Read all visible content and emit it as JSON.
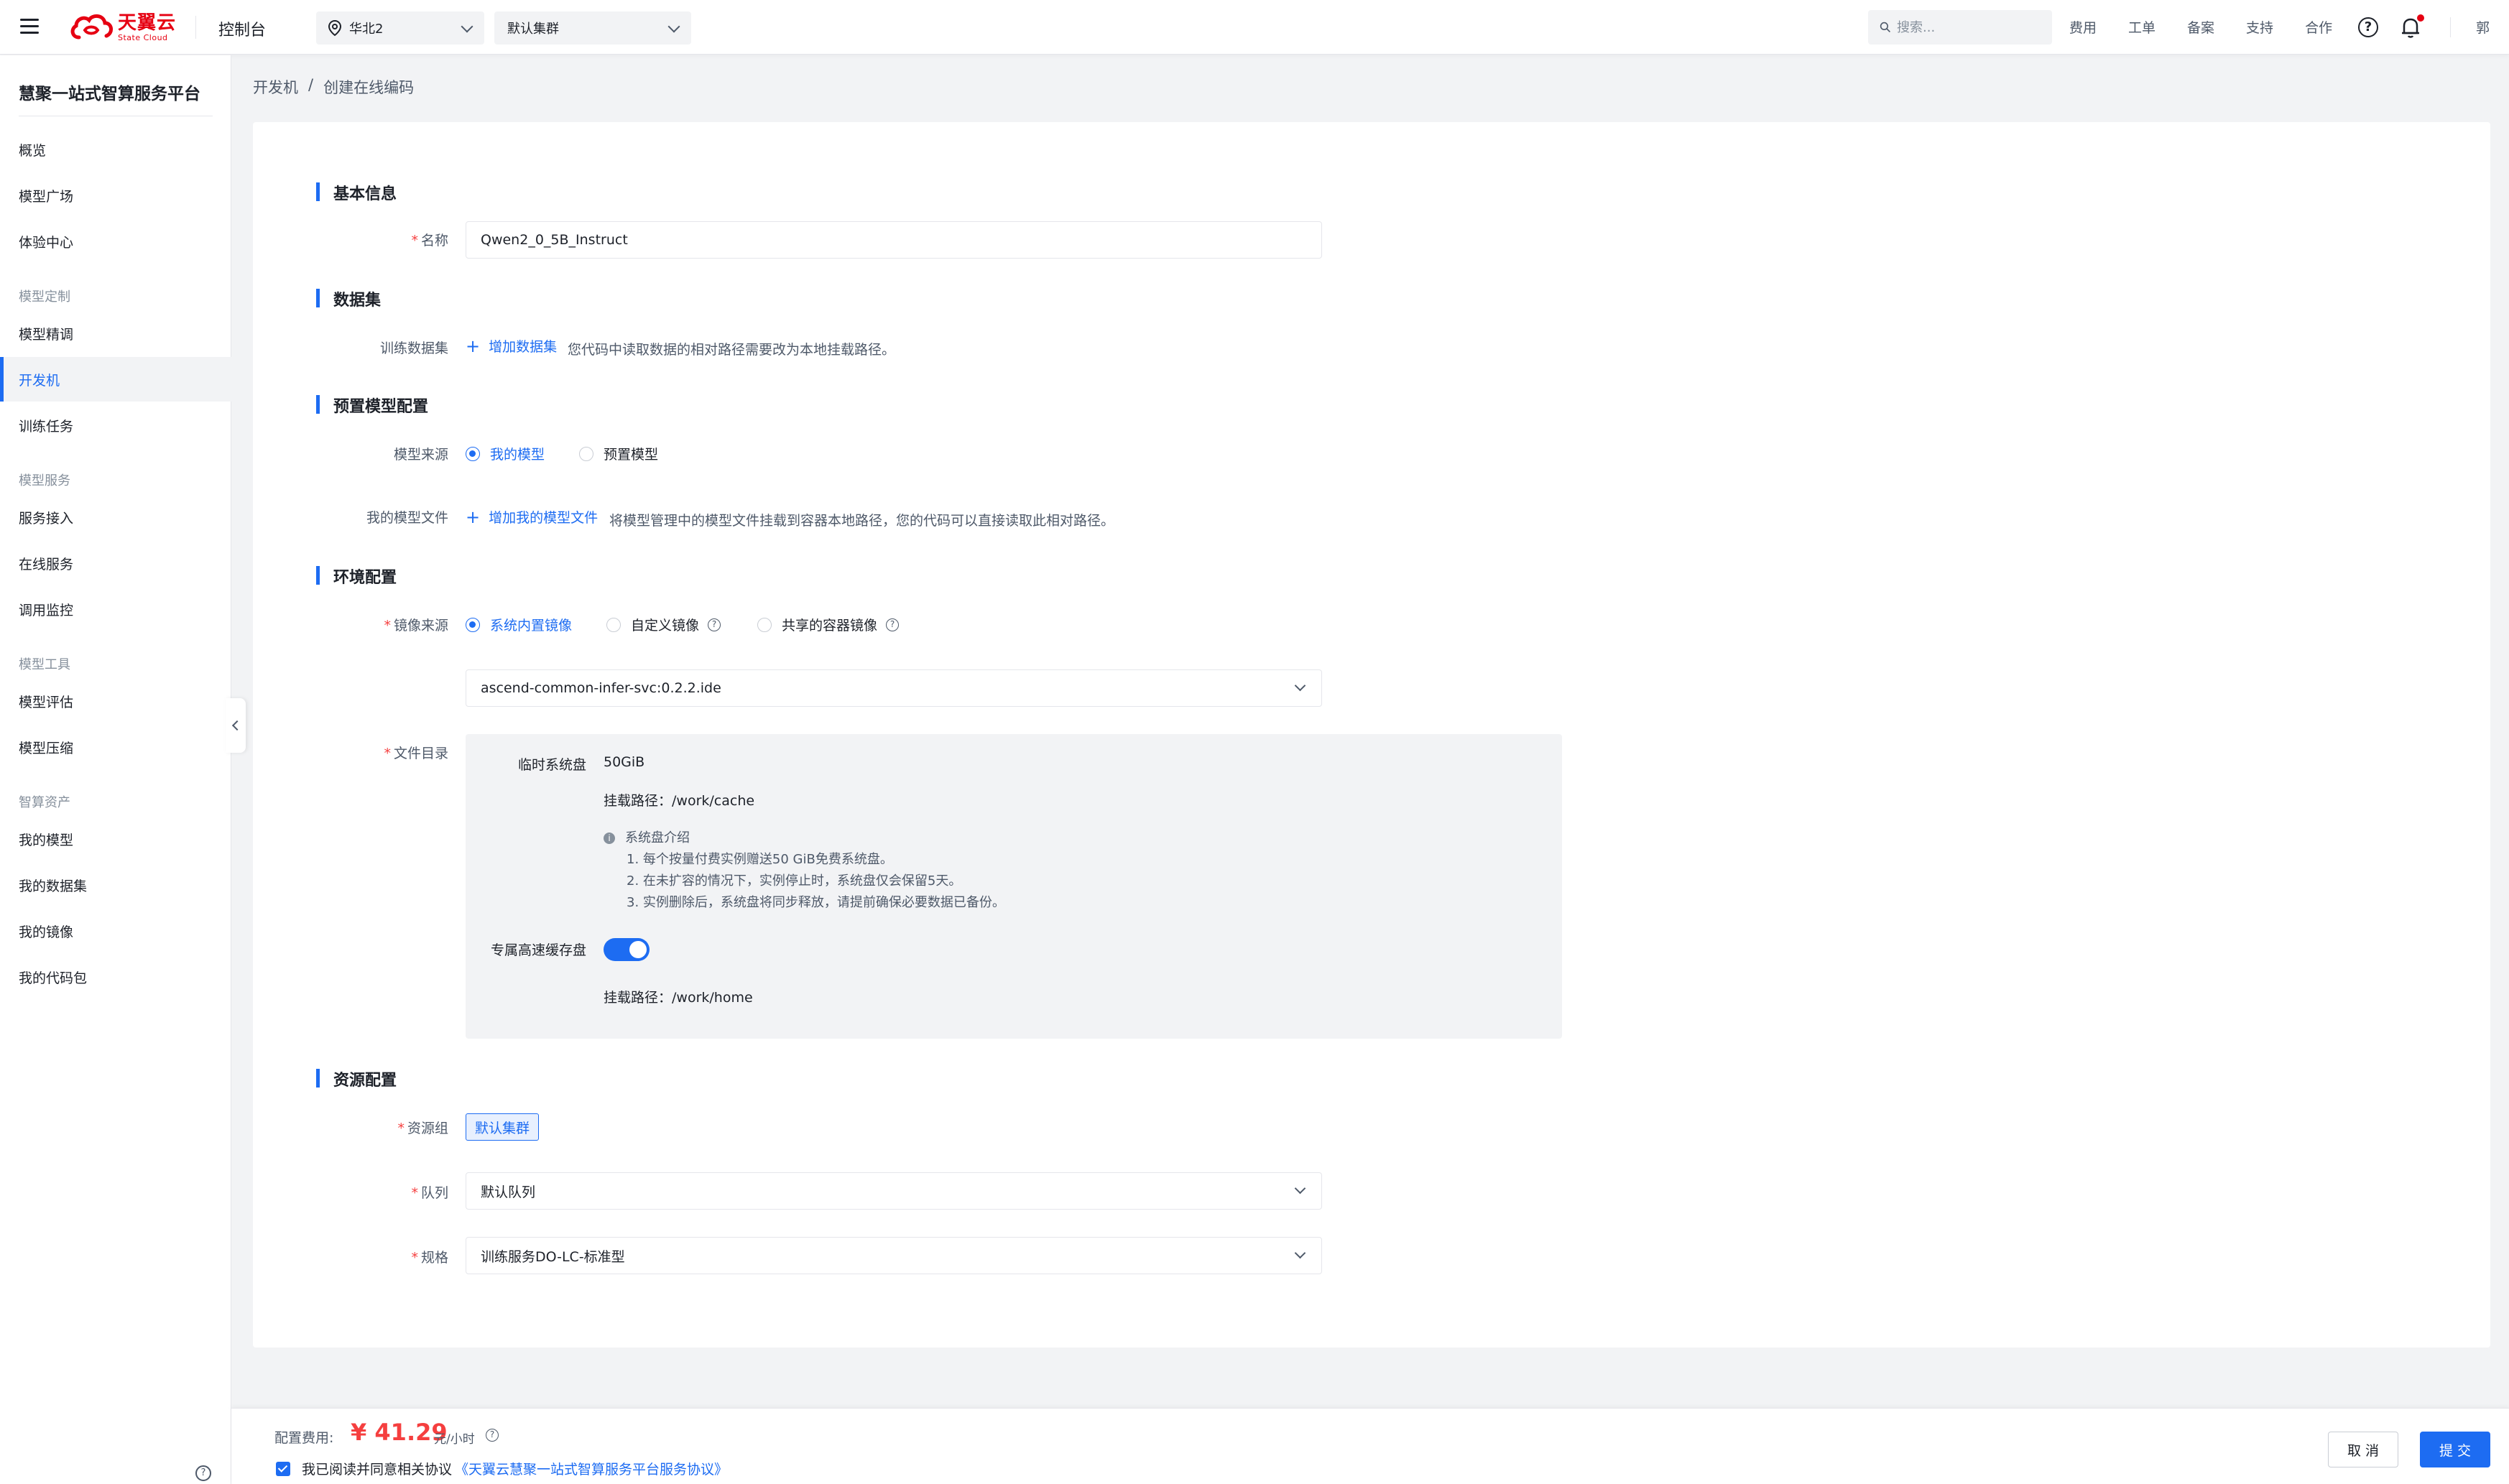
{
  "topbar": {
    "logo_cn": "天翼云",
    "logo_en": "State Cloud",
    "console": "控制台",
    "region": "华北2",
    "cluster": "默认集群",
    "search_placeholder": "搜索...",
    "links": [
      "费用",
      "工单",
      "备案",
      "支持",
      "合作"
    ],
    "help": "?",
    "user": "郭"
  },
  "sidebar": {
    "title": "慧聚一站式智算服务平台",
    "items": [
      {
        "label": "概览"
      },
      {
        "label": "模型广场"
      },
      {
        "label": "体验中心"
      },
      {
        "group": "模型定制"
      },
      {
        "label": "模型精调"
      },
      {
        "label": "开发机",
        "active": true
      },
      {
        "label": "训练任务"
      },
      {
        "group": "模型服务"
      },
      {
        "label": "服务接入"
      },
      {
        "label": "在线服务"
      },
      {
        "label": "调用监控"
      },
      {
        "group": "模型工具"
      },
      {
        "label": "模型评估"
      },
      {
        "label": "模型压缩"
      },
      {
        "group": "智算资产"
      },
      {
        "label": "我的模型"
      },
      {
        "label": "我的数据集"
      },
      {
        "label": "我的镜像"
      },
      {
        "label": "我的代码包"
      }
    ]
  },
  "breadcrumb": {
    "parent": "开发机",
    "separator": "/",
    "current": "创建在线编码"
  },
  "form": {
    "basic": {
      "title": "基本信息",
      "name_label": "名称",
      "name_value": "Qwen2_0_5B_Instruct"
    },
    "dataset": {
      "title": "数据集",
      "train_label": "训练数据集",
      "add_label": "增加数据集",
      "hint": "您代码中读取数据的相对路径需要改为本地挂载路径。"
    },
    "model": {
      "title": "预置模型配置",
      "source_label": "模型来源",
      "source_options": [
        "我的模型",
        "预置模型"
      ],
      "source_selected": "我的模型",
      "file_label": "我的模型文件",
      "add_label": "增加我的模型文件",
      "hint": "将模型管理中的模型文件挂载到容器本地路径，您的代码可以直接读取此相对路径。"
    },
    "env": {
      "title": "环境配置",
      "image_label": "镜像来源",
      "image_options": [
        "系统内置镜像",
        "自定义镜像",
        "共享的容器镜像"
      ],
      "image_selected": "系统内置镜像",
      "image_value": "ascend-common-infer-svc:0.2.2.ide",
      "dir_label": "文件目录",
      "temp_disk_label": "临时系统盘",
      "temp_disk_value": "50GiB",
      "temp_mount": "挂载路径：/work/cache",
      "note_title": "系统盘介绍",
      "note_lines": [
        "1. 每个按量付费实例赠送50 GiB免费系统盘。",
        "2. 在未扩容的情况下，实例停止时，系统盘仅会保留5天。",
        "3. 实例删除后，系统盘将同步释放，请提前确保必要数据已备份。"
      ],
      "cache_label": "专属高速缓存盘",
      "cache_enabled": true,
      "cache_mount": "挂载路径：/work/home"
    },
    "resource": {
      "title": "资源配置",
      "group_label": "资源组",
      "group_tag": "默认集群",
      "queue_label": "队列",
      "queue_value": "默认队列",
      "spec_label": "规格",
      "spec_value": "训练服务DO-LC-标准型"
    }
  },
  "footer": {
    "fee_label": "配置费用:",
    "fee_value": "¥ 41.29",
    "fee_unit": "元/小时",
    "agree_text": "我已阅读并同意相关协议",
    "agree_link": "《天翼云慧聚一站式智算服务平台服务协议》",
    "cancel": "取 消",
    "submit": "提 交"
  },
  "colors": {
    "primary": "#1d6cf2",
    "brand_red": "#e60012",
    "price_red": "#f53f3f"
  }
}
